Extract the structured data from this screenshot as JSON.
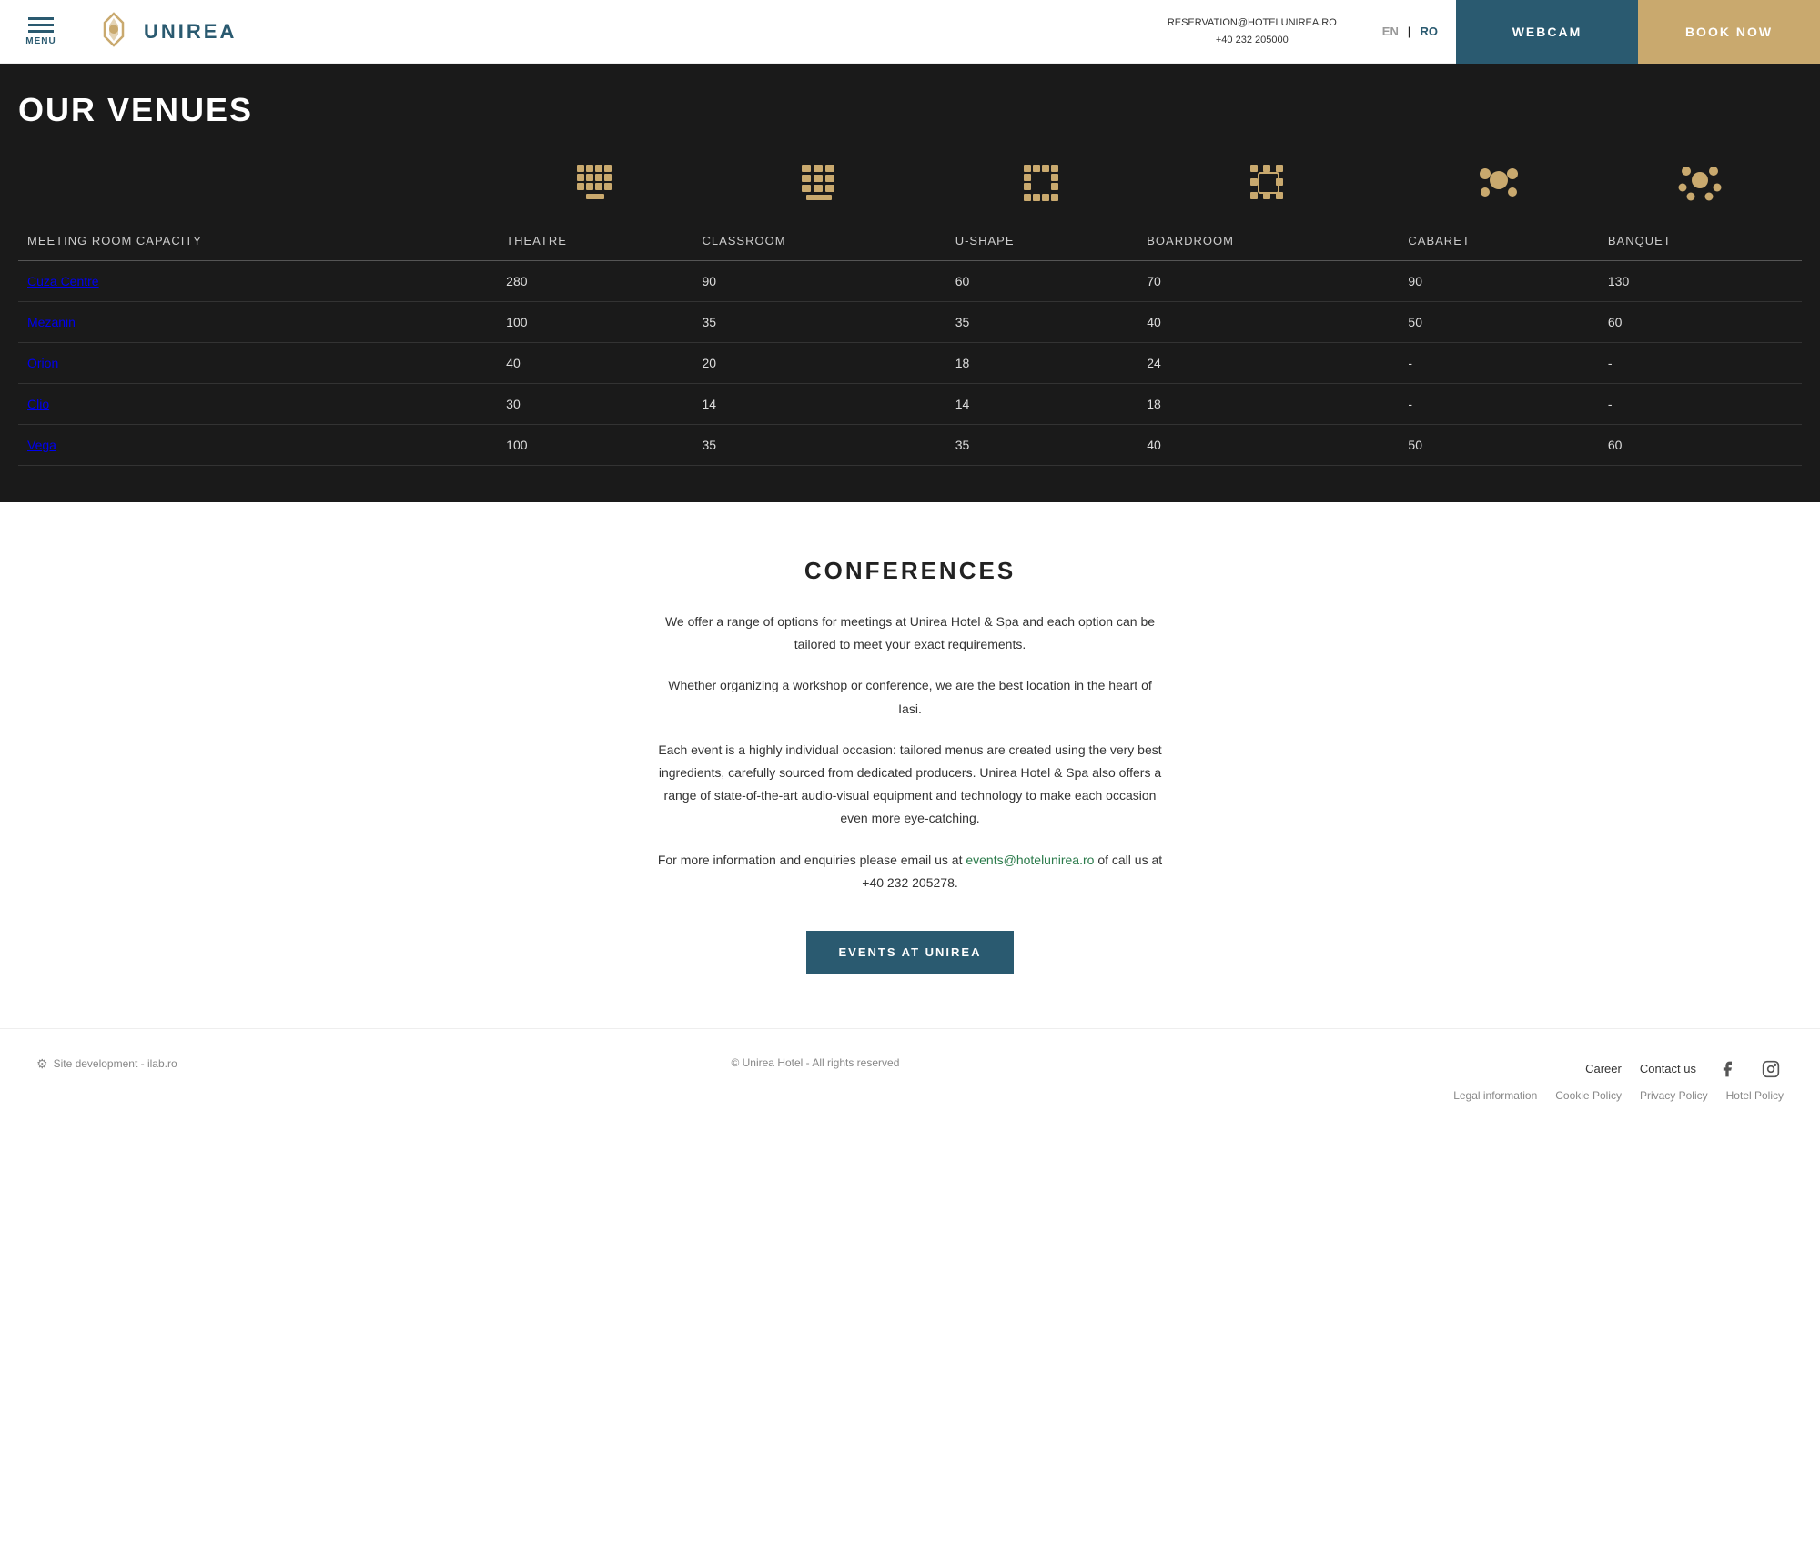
{
  "header": {
    "menu_label": "MENU",
    "logo_text": "UNIREA",
    "email": "RESERVATION@HOTELUNIREA.RO",
    "phone": "+40 232 205000",
    "lang_en": "EN",
    "lang_ro": "RO",
    "webcam_label": "WEBCAM",
    "book_label": "BOOK NOW"
  },
  "venues": {
    "title": "OUR VENUES",
    "capacity_label": "MEETING ROOM CAPACITY",
    "columns": [
      "THEATRE",
      "CLASSROOM",
      "U-SHAPE",
      "BOARDROOM",
      "CABARET",
      "BANQUET"
    ],
    "rows": [
      {
        "name": "Cuza Centre",
        "values": [
          "280",
          "90",
          "60",
          "70",
          "90",
          "130"
        ]
      },
      {
        "name": "Mezanin",
        "values": [
          "100",
          "35",
          "35",
          "40",
          "50",
          "60"
        ]
      },
      {
        "name": "Orion",
        "values": [
          "40",
          "20",
          "18",
          "24",
          "-",
          "-"
        ]
      },
      {
        "name": "Clio",
        "values": [
          "30",
          "14",
          "14",
          "18",
          "-",
          "-"
        ]
      },
      {
        "name": "Vega",
        "values": [
          "100",
          "35",
          "35",
          "40",
          "50",
          "60"
        ]
      }
    ]
  },
  "conferences": {
    "title": "CONFERENCES",
    "paragraph1": "We offer a range of options for meetings at Unirea Hotel & Spa and each option can be tailored to meet your exact requirements.",
    "paragraph2": "Whether organizing a workshop or conference, we are the best location in the heart of Iasi.",
    "paragraph3": "Each event is a highly individual occasion: tailored menus are created using the very best ingredients, carefully sourced from dedicated producers. Unirea Hotel & Spa also offers a range of state-of-the-art audio-visual equipment and technology to make each occasion even more eye-catching.",
    "paragraph4_before": "For more information and enquiries please email us at ",
    "paragraph4_email": "events@hotelunirea.ro",
    "paragraph4_after": " of call us at +40 232 205278.",
    "button_label": "EVENTS AT UNIREA"
  },
  "footer": {
    "site_dev": "Site development - ilab.ro",
    "copyright": "© Unirea Hotel - All rights reserved",
    "links_top": [
      "Career",
      "Contact us"
    ],
    "links_bottom": [
      "Legal information",
      "Cookie Policy",
      "Privacy Policy",
      "Hotel Policy"
    ]
  }
}
